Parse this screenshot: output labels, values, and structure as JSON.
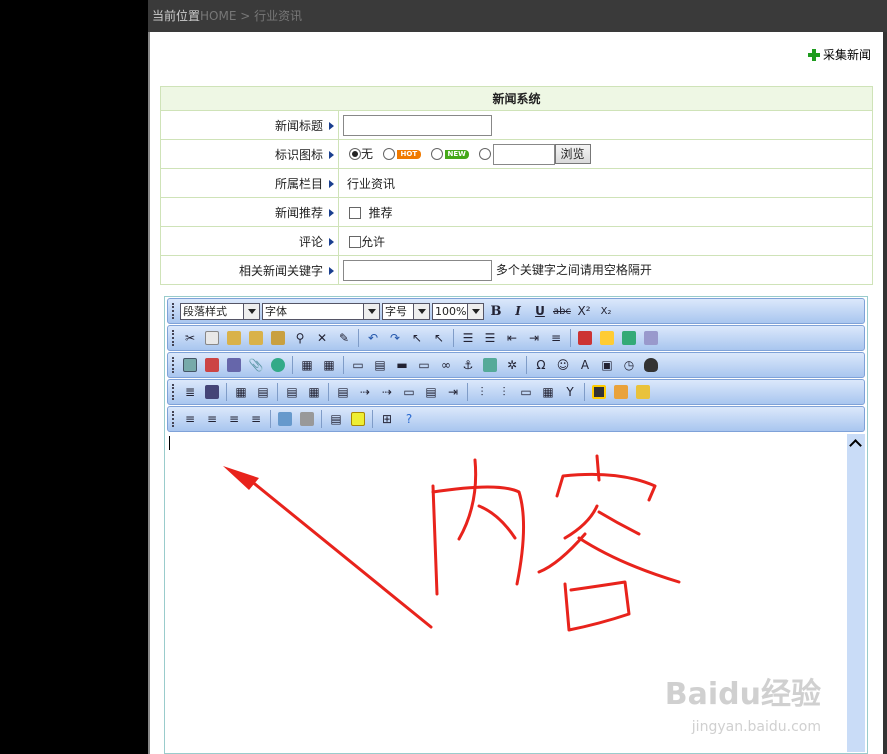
{
  "breadcrumb": {
    "current": "当前位置",
    "home": "HOME",
    "sep": " > ",
    "section": "行业资讯"
  },
  "collect_label": "采集新闻",
  "form": {
    "header": "新闻系统",
    "title_label": "新闻标题",
    "icon_label": "标识图标",
    "icon_none": "无",
    "icon_hot": "HOT",
    "icon_new": "NEW",
    "browse_label": "浏览",
    "category_label": "所属栏目",
    "category_value": "行业资讯",
    "recommend_label": "新闻推荐",
    "recommend_text": "推荐",
    "comment_label": "评论",
    "comment_text": "允许",
    "keywords_label": "相关新闻关键字",
    "keywords_hint": "多个关键字之间请用空格隔开"
  },
  "editor": {
    "paragraph_style": "段落样式",
    "font": "字体",
    "font_size": "字号",
    "zoom": "100%",
    "bold": "B",
    "italic": "I",
    "underline": "U",
    "strike": "abc",
    "superscript": "X²",
    "subscript": "X₂"
  },
  "annotation_text": "内容",
  "watermark": {
    "brand": "Baidu经验",
    "url": "jingyan.baidu.com"
  },
  "colors": {
    "accent_green": "#1e9c1e",
    "annotation_red": "#e8231c",
    "toolbar_blue": "#a9c6ef"
  }
}
